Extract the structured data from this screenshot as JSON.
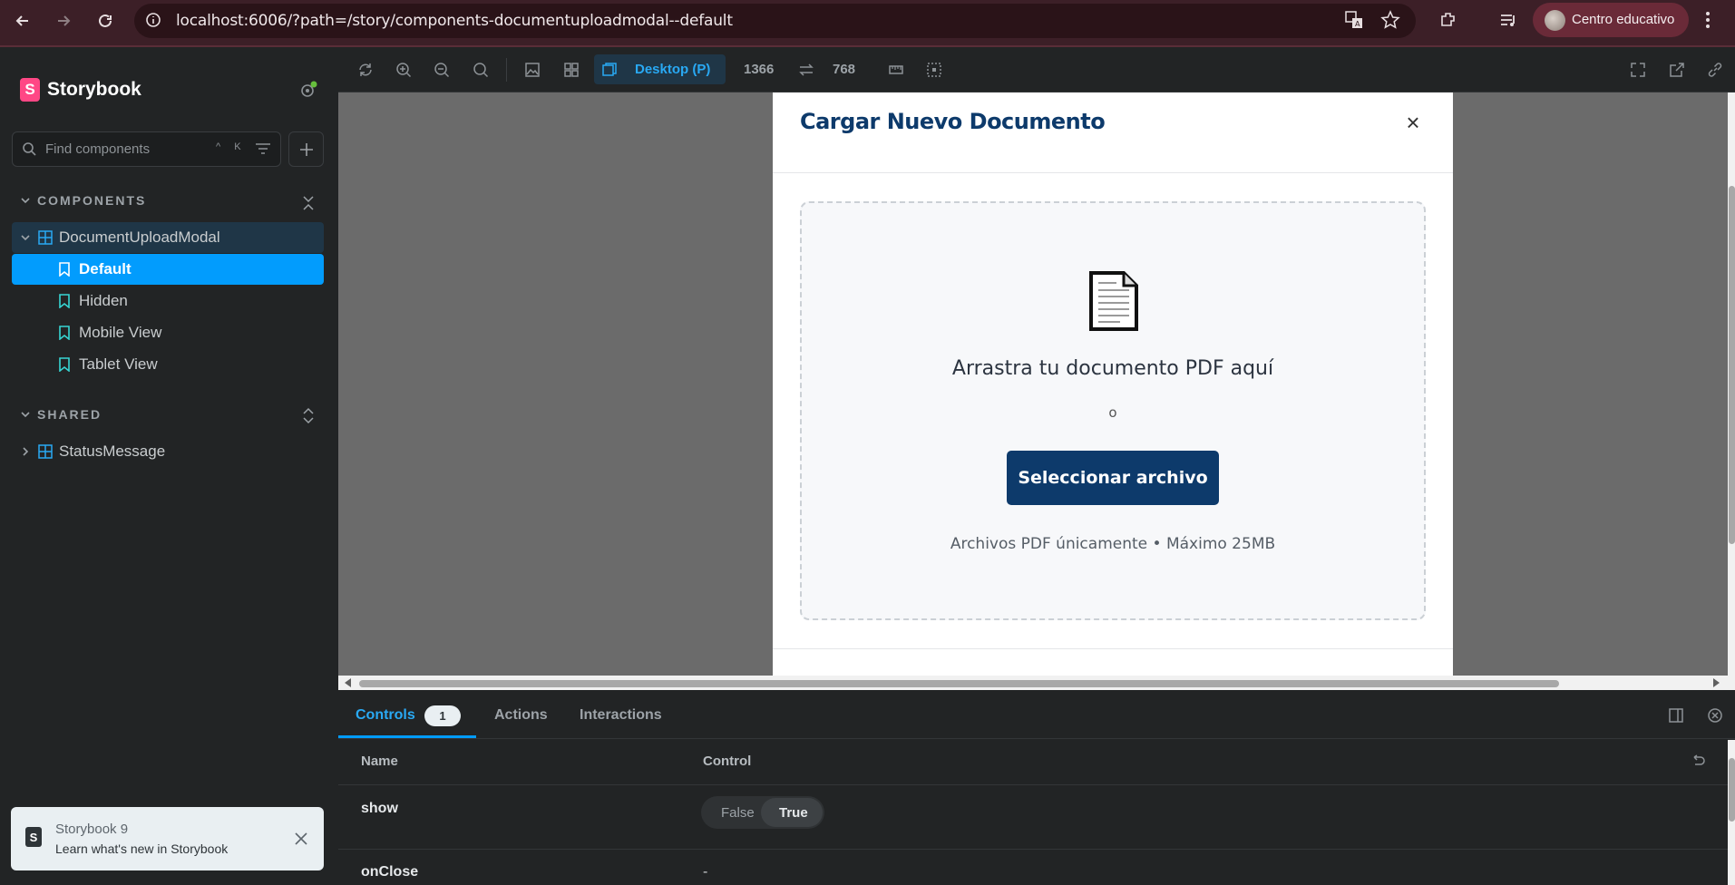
{
  "browser": {
    "url": "localhost:6006/?path=/story/components-documentuploadmodal--default",
    "profile_name": "Centro educativo"
  },
  "sidebar": {
    "app_title": "Storybook",
    "search_placeholder": "Find components",
    "search_shortcut": "^ K",
    "sections": [
      {
        "title": "COMPONENTS",
        "component": "DocumentUploadModal",
        "stories": [
          "Default",
          "Hidden",
          "Mobile View",
          "Tablet View"
        ]
      },
      {
        "title": "SHARED",
        "component": "StatusMessage"
      }
    ],
    "toast": {
      "title": "Storybook 9",
      "subtitle": "Learn what's new in Storybook"
    }
  },
  "toolbar": {
    "viewport_label": "Desktop (P)",
    "width": "1366",
    "height": "768"
  },
  "modal": {
    "title": "Cargar Nuevo Documento",
    "close_symbol": "×",
    "drop_title": "Arrastra tu documento PDF aquí",
    "or_text": "o",
    "select_button": "Seleccionar archivo",
    "hint": "Archivos PDF únicamente • Máximo 25MB"
  },
  "addons": {
    "tabs": [
      "Controls",
      "Actions",
      "Interactions"
    ],
    "controls_count": "1",
    "columns": [
      "Name",
      "Control"
    ],
    "rows": [
      {
        "name": "show",
        "false_label": "False",
        "true_label": "True",
        "selected": "True"
      },
      {
        "name": "onClose",
        "value": "-"
      }
    ]
  },
  "colors": {
    "accent": "#029cfd",
    "modal_primary": "#0d3a6b",
    "storybook_pink": "#ff4785",
    "chrome_bg": "#3c1f27"
  }
}
